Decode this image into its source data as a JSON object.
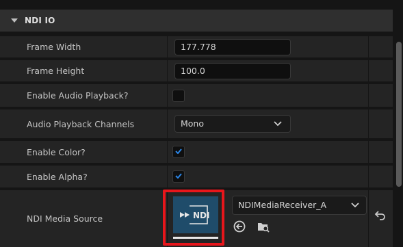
{
  "section": {
    "title": "NDI IO"
  },
  "properties": {
    "frame_width": {
      "label": "Frame Width",
      "value": "177.778"
    },
    "frame_height": {
      "label": "Frame Height",
      "value": "100.0"
    },
    "enable_audio": {
      "label": "Enable Audio Playback?",
      "checked": false
    },
    "audio_channels": {
      "label": "Audio Playback Channels",
      "value": "Mono"
    },
    "enable_color": {
      "label": "Enable Color?",
      "checked": true
    },
    "enable_alpha": {
      "label": "Enable Alpha?",
      "checked": true
    },
    "media_source": {
      "label": "NDI Media Source",
      "asset": "NDIMediaReceiver_A",
      "thumbnail_text": "NDI"
    }
  },
  "colors": {
    "accent": "#1f7ad6",
    "highlight": "#e8161b"
  },
  "icons": [
    "caret-down-icon",
    "chevron-down-icon",
    "checkmark-icon",
    "use-selected-arrow-icon",
    "browse-folder-icon",
    "reset-arrow-icon"
  ]
}
